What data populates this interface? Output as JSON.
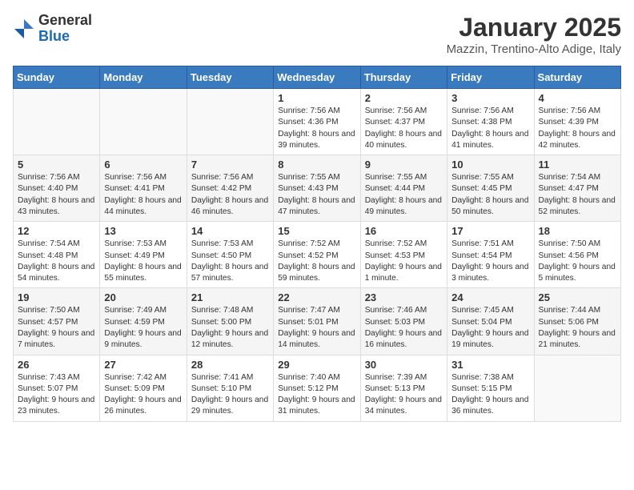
{
  "header": {
    "logo_general": "General",
    "logo_blue": "Blue",
    "month_title": "January 2025",
    "location": "Mazzin, Trentino-Alto Adige, Italy"
  },
  "days_of_week": [
    "Sunday",
    "Monday",
    "Tuesday",
    "Wednesday",
    "Thursday",
    "Friday",
    "Saturday"
  ],
  "weeks": [
    {
      "days": [
        {
          "number": "",
          "info": ""
        },
        {
          "number": "",
          "info": ""
        },
        {
          "number": "",
          "info": ""
        },
        {
          "number": "1",
          "info": "Sunrise: 7:56 AM\nSunset: 4:36 PM\nDaylight: 8 hours and 39 minutes."
        },
        {
          "number": "2",
          "info": "Sunrise: 7:56 AM\nSunset: 4:37 PM\nDaylight: 8 hours and 40 minutes."
        },
        {
          "number": "3",
          "info": "Sunrise: 7:56 AM\nSunset: 4:38 PM\nDaylight: 8 hours and 41 minutes."
        },
        {
          "number": "4",
          "info": "Sunrise: 7:56 AM\nSunset: 4:39 PM\nDaylight: 8 hours and 42 minutes."
        }
      ]
    },
    {
      "days": [
        {
          "number": "5",
          "info": "Sunrise: 7:56 AM\nSunset: 4:40 PM\nDaylight: 8 hours and 43 minutes."
        },
        {
          "number": "6",
          "info": "Sunrise: 7:56 AM\nSunset: 4:41 PM\nDaylight: 8 hours and 44 minutes."
        },
        {
          "number": "7",
          "info": "Sunrise: 7:56 AM\nSunset: 4:42 PM\nDaylight: 8 hours and 46 minutes."
        },
        {
          "number": "8",
          "info": "Sunrise: 7:55 AM\nSunset: 4:43 PM\nDaylight: 8 hours and 47 minutes."
        },
        {
          "number": "9",
          "info": "Sunrise: 7:55 AM\nSunset: 4:44 PM\nDaylight: 8 hours and 49 minutes."
        },
        {
          "number": "10",
          "info": "Sunrise: 7:55 AM\nSunset: 4:45 PM\nDaylight: 8 hours and 50 minutes."
        },
        {
          "number": "11",
          "info": "Sunrise: 7:54 AM\nSunset: 4:47 PM\nDaylight: 8 hours and 52 minutes."
        }
      ]
    },
    {
      "days": [
        {
          "number": "12",
          "info": "Sunrise: 7:54 AM\nSunset: 4:48 PM\nDaylight: 8 hours and 54 minutes."
        },
        {
          "number": "13",
          "info": "Sunrise: 7:53 AM\nSunset: 4:49 PM\nDaylight: 8 hours and 55 minutes."
        },
        {
          "number": "14",
          "info": "Sunrise: 7:53 AM\nSunset: 4:50 PM\nDaylight: 8 hours and 57 minutes."
        },
        {
          "number": "15",
          "info": "Sunrise: 7:52 AM\nSunset: 4:52 PM\nDaylight: 8 hours and 59 minutes."
        },
        {
          "number": "16",
          "info": "Sunrise: 7:52 AM\nSunset: 4:53 PM\nDaylight: 9 hours and 1 minute."
        },
        {
          "number": "17",
          "info": "Sunrise: 7:51 AM\nSunset: 4:54 PM\nDaylight: 9 hours and 3 minutes."
        },
        {
          "number": "18",
          "info": "Sunrise: 7:50 AM\nSunset: 4:56 PM\nDaylight: 9 hours and 5 minutes."
        }
      ]
    },
    {
      "days": [
        {
          "number": "19",
          "info": "Sunrise: 7:50 AM\nSunset: 4:57 PM\nDaylight: 9 hours and 7 minutes."
        },
        {
          "number": "20",
          "info": "Sunrise: 7:49 AM\nSunset: 4:59 PM\nDaylight: 9 hours and 9 minutes."
        },
        {
          "number": "21",
          "info": "Sunrise: 7:48 AM\nSunset: 5:00 PM\nDaylight: 9 hours and 12 minutes."
        },
        {
          "number": "22",
          "info": "Sunrise: 7:47 AM\nSunset: 5:01 PM\nDaylight: 9 hours and 14 minutes."
        },
        {
          "number": "23",
          "info": "Sunrise: 7:46 AM\nSunset: 5:03 PM\nDaylight: 9 hours and 16 minutes."
        },
        {
          "number": "24",
          "info": "Sunrise: 7:45 AM\nSunset: 5:04 PM\nDaylight: 9 hours and 19 minutes."
        },
        {
          "number": "25",
          "info": "Sunrise: 7:44 AM\nSunset: 5:06 PM\nDaylight: 9 hours and 21 minutes."
        }
      ]
    },
    {
      "days": [
        {
          "number": "26",
          "info": "Sunrise: 7:43 AM\nSunset: 5:07 PM\nDaylight: 9 hours and 23 minutes."
        },
        {
          "number": "27",
          "info": "Sunrise: 7:42 AM\nSunset: 5:09 PM\nDaylight: 9 hours and 26 minutes."
        },
        {
          "number": "28",
          "info": "Sunrise: 7:41 AM\nSunset: 5:10 PM\nDaylight: 9 hours and 29 minutes."
        },
        {
          "number": "29",
          "info": "Sunrise: 7:40 AM\nSunset: 5:12 PM\nDaylight: 9 hours and 31 minutes."
        },
        {
          "number": "30",
          "info": "Sunrise: 7:39 AM\nSunset: 5:13 PM\nDaylight: 9 hours and 34 minutes."
        },
        {
          "number": "31",
          "info": "Sunrise: 7:38 AM\nSunset: 5:15 PM\nDaylight: 9 hours and 36 minutes."
        },
        {
          "number": "",
          "info": ""
        }
      ]
    }
  ]
}
